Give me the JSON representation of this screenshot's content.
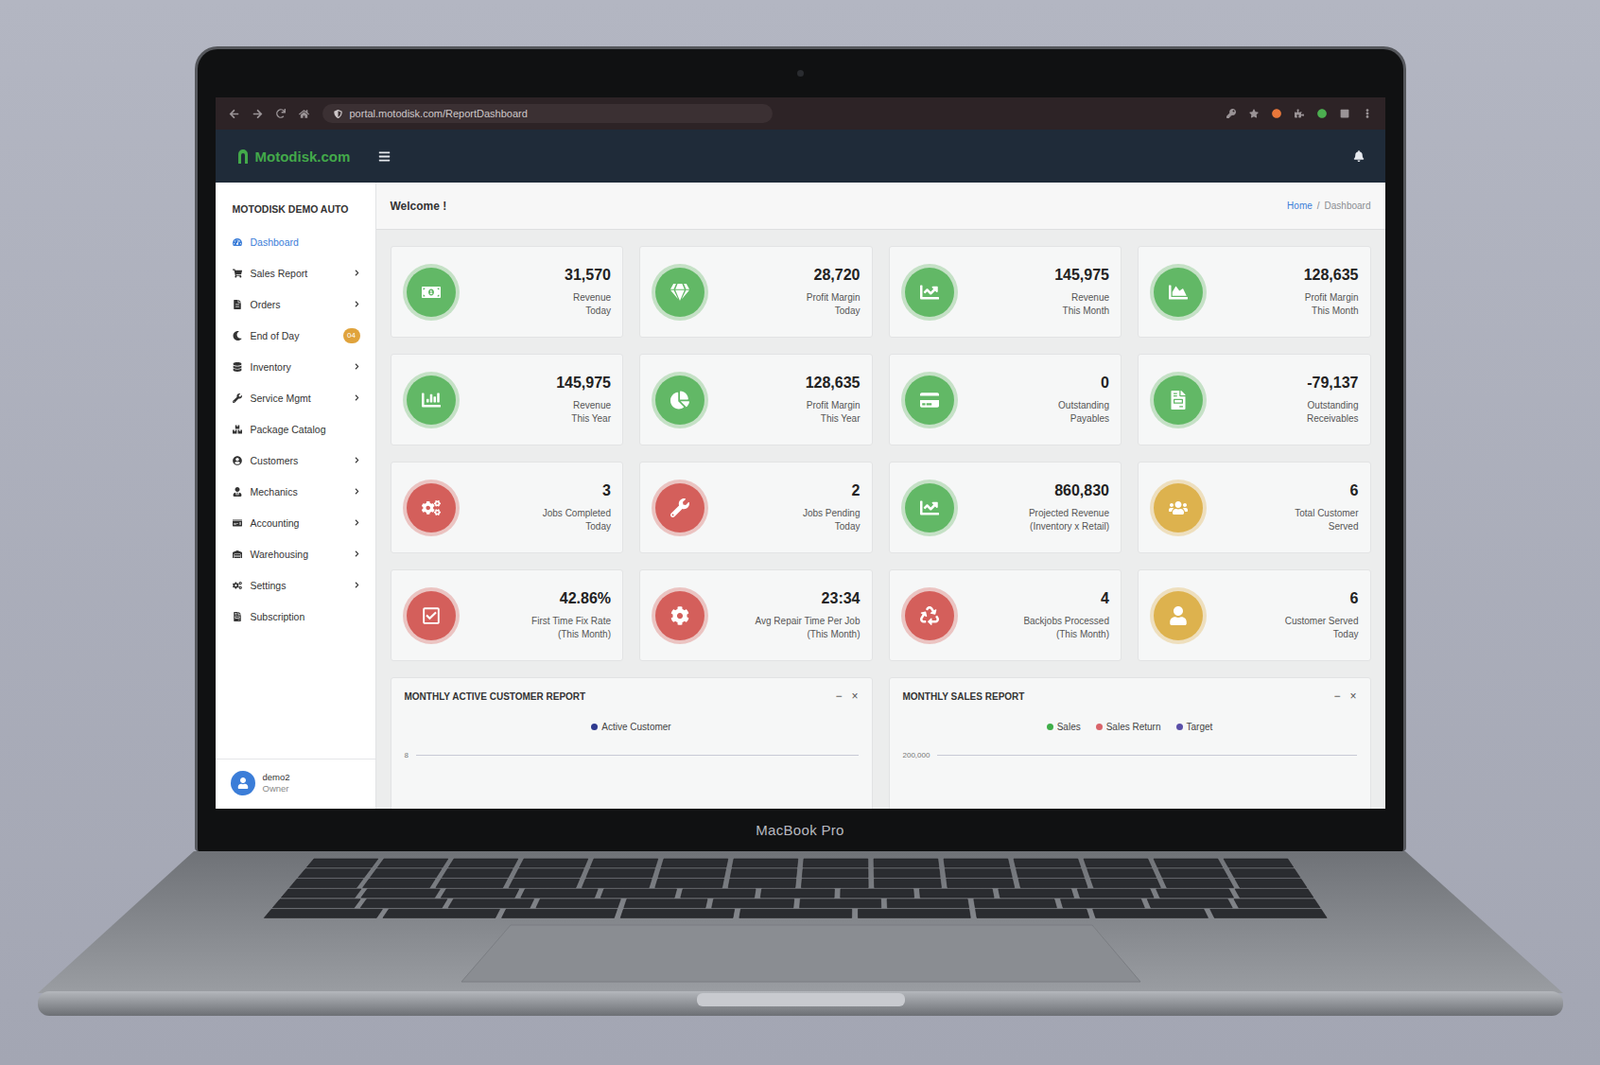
{
  "browser": {
    "url": "portal.motodisk.com/ReportDashboard"
  },
  "app": {
    "logo": "Motodisk.com"
  },
  "sidebar": {
    "title": "MOTODISK DEMO AUTO",
    "items": [
      {
        "label": "Dashboard",
        "selected": true,
        "has_submenu": false,
        "badge": ""
      },
      {
        "label": "Sales Report",
        "selected": false,
        "has_submenu": true,
        "badge": ""
      },
      {
        "label": "Orders",
        "selected": false,
        "has_submenu": true,
        "badge": ""
      },
      {
        "label": "End of Day",
        "selected": false,
        "has_submenu": false,
        "badge": "04"
      },
      {
        "label": "Inventory",
        "selected": false,
        "has_submenu": true,
        "badge": ""
      },
      {
        "label": "Service Mgmt",
        "selected": false,
        "has_submenu": true,
        "badge": ""
      },
      {
        "label": "Package Catalog",
        "selected": false,
        "has_submenu": false,
        "badge": ""
      },
      {
        "label": "Customers",
        "selected": false,
        "has_submenu": true,
        "badge": ""
      },
      {
        "label": "Mechanics",
        "selected": false,
        "has_submenu": true,
        "badge": ""
      },
      {
        "label": "Accounting",
        "selected": false,
        "has_submenu": true,
        "badge": ""
      },
      {
        "label": "Warehousing",
        "selected": false,
        "has_submenu": true,
        "badge": ""
      },
      {
        "label": "Settings",
        "selected": false,
        "has_submenu": true,
        "badge": ""
      },
      {
        "label": "Subscription",
        "selected": false,
        "has_submenu": false,
        "badge": ""
      }
    ],
    "user": {
      "name": "demo2",
      "role": "Owner"
    }
  },
  "page": {
    "welcome": "Welcome !",
    "breadcrumb": [
      {
        "label": "Home",
        "selected": false
      },
      {
        "label": "Dashboard",
        "selected": true
      }
    ],
    "separator": "/"
  },
  "cards": [
    {
      "value": "31,570",
      "label": [
        "Revenue",
        "Today"
      ],
      "color": "#62b866"
    },
    {
      "value": "28,720",
      "label": [
        "Profit Margin",
        "Today"
      ],
      "color": "#62b866"
    },
    {
      "value": "145,975",
      "label": [
        "Revenue",
        "This Month"
      ],
      "color": "#62b866"
    },
    {
      "value": "128,635",
      "label": [
        "Profit Margin",
        "This Month"
      ],
      "color": "#62b866"
    },
    {
      "value": "145,975",
      "label": [
        "Revenue",
        "This Year"
      ],
      "color": "#62b866"
    },
    {
      "value": "128,635",
      "label": [
        "Profit Margin",
        "This Year"
      ],
      "color": "#62b866"
    },
    {
      "value": "0",
      "label": [
        "Outstanding",
        "Payables"
      ],
      "color": "#62b866"
    },
    {
      "value": "-79,137",
      "label": [
        "Outstanding",
        "Receivables"
      ],
      "color": "#62b866"
    },
    {
      "value": "3",
      "label": [
        "Jobs Completed",
        "Today"
      ],
      "color": "#d45f5b"
    },
    {
      "value": "2",
      "label": [
        "Jobs Pending",
        "Today"
      ],
      "color": "#d45f5b"
    },
    {
      "value": "860,830",
      "label": [
        "Projected Revenue",
        "(Inventory x Retail)"
      ],
      "color": "#62b866"
    },
    {
      "value": "6",
      "label": [
        "Total Customer",
        "Served"
      ],
      "color": "#ddb24e"
    },
    {
      "value": "42.86%",
      "label": [
        "First Time Fix Rate",
        "(This Month)"
      ],
      "color": "#d45f5b"
    },
    {
      "value": "23:34",
      "label": [
        "Avg Repair Time Per Job",
        "(This Month)"
      ],
      "color": "#d45f5b"
    },
    {
      "value": "4",
      "label": [
        "Backjobs Processed",
        "(This Month)"
      ],
      "color": "#d45f5b"
    },
    {
      "value": "6",
      "label": [
        "Customer Served",
        "Today"
      ],
      "color": "#ddb24e"
    }
  ],
  "charts": [
    {
      "title": "MONTHLY ACTIVE CUSTOMER REPORT",
      "controls": [
        "−",
        "×"
      ],
      "legend": [
        {
          "label": "Active Customer",
          "color": "#2f3a8f"
        }
      ],
      "tick": "8"
    },
    {
      "title": "MONTHLY SALES REPORT",
      "controls": [
        "−",
        "×"
      ],
      "legend": [
        {
          "label": "Sales",
          "color": "#3fae49"
        },
        {
          "label": "Sales Return",
          "color": "#d9646a"
        },
        {
          "label": "Target",
          "color": "#5a4fa8"
        }
      ],
      "tick": "200,000"
    }
  ],
  "laptop": {
    "model": "MacBook Pro"
  }
}
